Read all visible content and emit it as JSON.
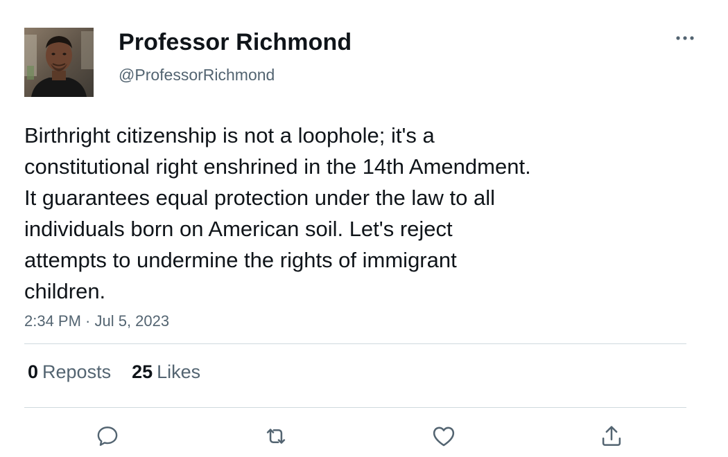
{
  "author": {
    "display_name": "Professor Richmond",
    "handle": "@ProfessorRichmond",
    "avatar_icon": "profile-photo"
  },
  "tweet": {
    "text_lines": [
      "Birthright citizenship is not a loophole; it's a",
      "constitutional right enshrined in the 14th Amendment.",
      "It guarantees equal protection under the law to all",
      "individuals born on American soil. Let's reject",
      "attempts to undermine the rights of immigrant",
      "children."
    ],
    "timestamp": "2:34 PM · Jul 5, 2023"
  },
  "stats": {
    "reposts_count": "0",
    "reposts_label": "Reposts",
    "likes_count": "25",
    "likes_label": "Likes"
  },
  "actions": {
    "reply_icon": "reply-icon",
    "repost_icon": "repost-icon",
    "like_icon": "like-icon",
    "share_icon": "share-icon",
    "more_icon": "more-icon"
  },
  "colors": {
    "text_primary": "#0f1419",
    "text_secondary": "#536471",
    "divider": "#cfd9de"
  }
}
